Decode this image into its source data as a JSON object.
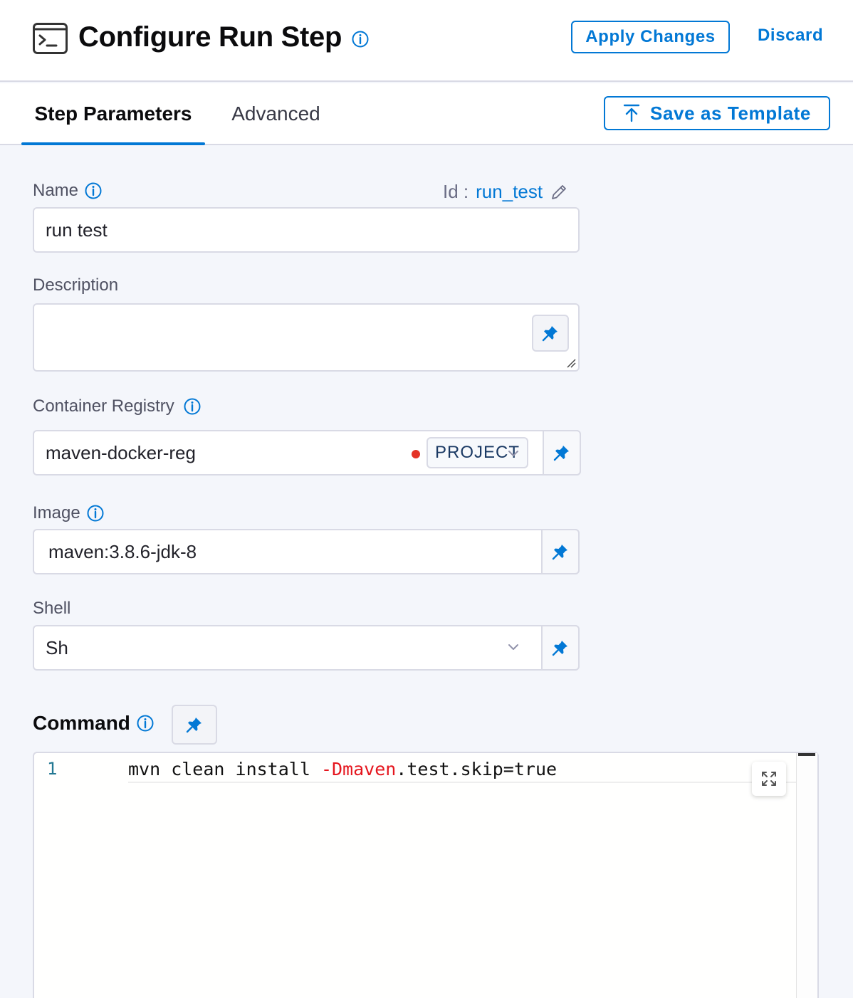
{
  "header": {
    "title": "Configure Run Step",
    "apply_label": "Apply Changes",
    "discard_label": "Discard"
  },
  "tabs": [
    {
      "label": "Step Parameters",
      "active": true
    },
    {
      "label": "Advanced",
      "active": false
    }
  ],
  "save_template_label": "Save as Template",
  "form": {
    "name": {
      "label": "Name",
      "value": "run test",
      "id_label": "Id :",
      "id_value": "run_test"
    },
    "description": {
      "label": "Description",
      "value": ""
    },
    "container_registry": {
      "label": "Container Registry",
      "value": "maven-docker-reg",
      "scope": "PROJECT"
    },
    "image": {
      "label": "Image",
      "value": "maven:3.8.6-jdk-8"
    },
    "shell": {
      "label": "Shell",
      "value": "Sh"
    },
    "command": {
      "label": "Command",
      "line_number": "1",
      "code_before": "mvn clean install ",
      "code_flag": "-Dmaven",
      "code_after": ".test.skip=true"
    }
  },
  "colors": {
    "accent": "#0278d5",
    "status_dot": "#e43326",
    "code_flag": "#e5161e"
  },
  "icons": [
    "terminal-icon",
    "info-icon",
    "upload-icon",
    "edit-icon",
    "pin-icon",
    "chevron-down-icon",
    "expand-icon",
    "resize-grip-icon"
  ]
}
